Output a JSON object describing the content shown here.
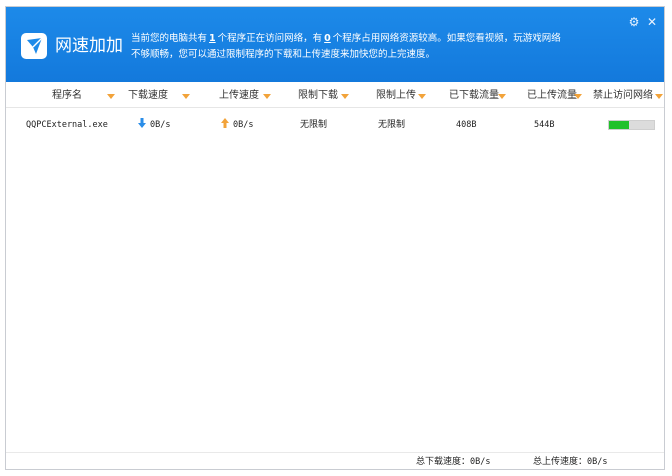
{
  "app": {
    "title": "网速加加"
  },
  "header": {
    "info_line1_pre": "当前您的电脑共有",
    "program_count": "1",
    "info_line1_mid": "个程序正在访问网络，有",
    "heavy_count": "0",
    "info_line1_post": "个程序占用网络资源较高。如果您看视频，玩游戏网络",
    "info_line2": "不够顺畅，您可以通过限制程序的下载和上传速度来加快您的上完速度。"
  },
  "columns": [
    "程序名",
    "下载速度",
    "上传速度",
    "限制下载",
    "限制上传",
    "已下载流量",
    "已上传流量",
    "禁止访问网络"
  ],
  "rows": [
    {
      "program": "QQPCExternal.exe",
      "download_speed": "0B/s",
      "upload_speed": "0B/s",
      "limit_download": "无限制",
      "limit_upload": "无限制",
      "downloaded": "408B",
      "uploaded": "544B",
      "block_network_level": 0.45
    }
  ],
  "footer": {
    "total_download_label": "总下载速度：",
    "total_download": "0B/s",
    "total_upload_label": "总上传速度：",
    "total_upload": "0B/s"
  },
  "colors": {
    "header": "#1379dc",
    "accent_orange": "#f2a33a",
    "download_blue": "#2a8de8",
    "toggle_green": "#21c12b"
  },
  "icons": {
    "logo": "paper-plane-logo-icon",
    "settings": "gear-icon",
    "close": "close-icon",
    "sort": "sort-arrow-icon"
  }
}
